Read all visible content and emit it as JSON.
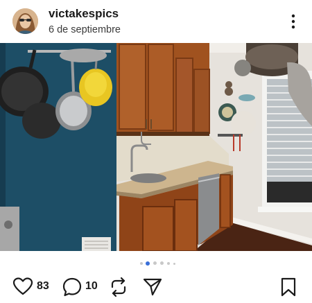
{
  "post": {
    "username": "victakespics",
    "date": "6 de septiembre"
  },
  "carousel": {
    "total": 6,
    "active_index": 1
  },
  "actions": {
    "likes": "83",
    "comments": "10"
  },
  "colors": {
    "active_dot": "#3a6fd8",
    "inactive_dot": "#c8c8c8",
    "wall_teal": "#1d4e66",
    "cabinet_wood": "#a0521f"
  }
}
